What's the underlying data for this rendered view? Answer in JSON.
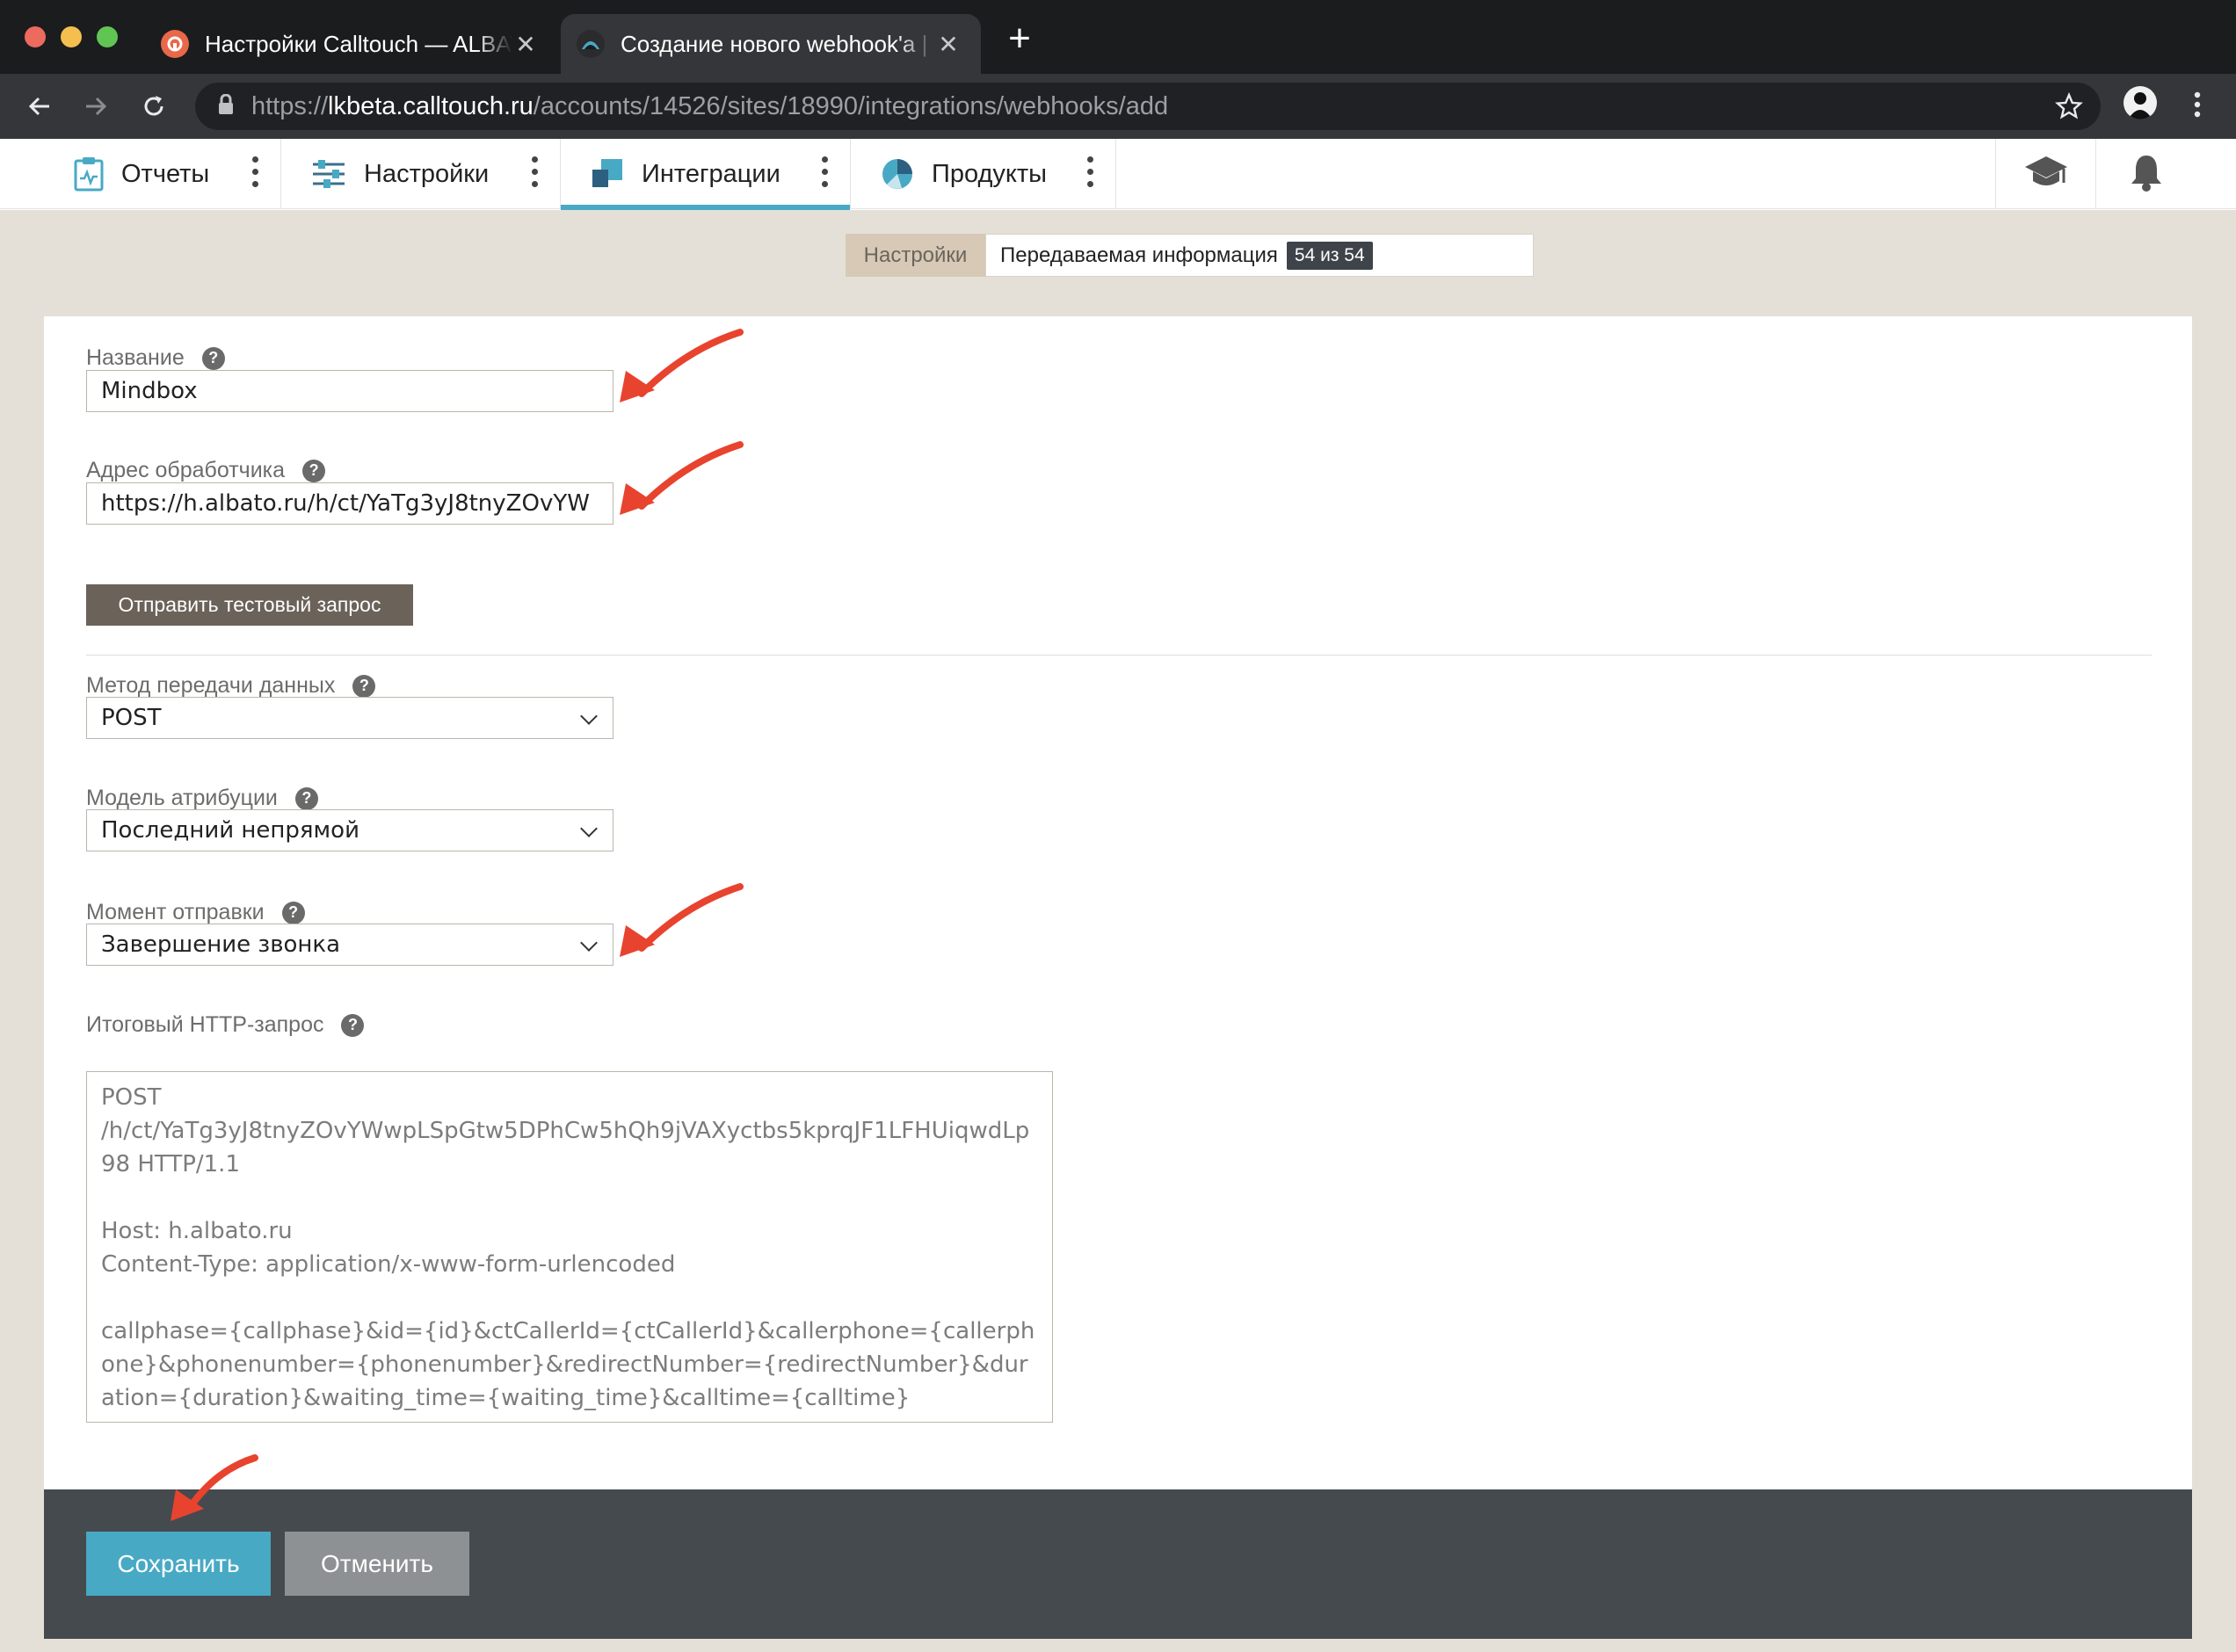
{
  "browser": {
    "tabs": [
      {
        "title": "Настройки Calltouch — ALBATO",
        "active": false
      },
      {
        "title": "Создание нового webhook'а | Calltouch",
        "active": true
      }
    ],
    "close_glyph": "✕",
    "new_tab_glyph": "+",
    "url": {
      "scheme": "https://",
      "host": "lkbeta.calltouch.ru",
      "path": "/accounts/14526/sites/18990/integrations/webhooks/add"
    }
  },
  "nav": {
    "items": [
      {
        "label": "Отчеты",
        "icon": "clipboard-chart-icon"
      },
      {
        "label": "Настройки",
        "icon": "sliders-icon"
      },
      {
        "label": "Интеграции",
        "icon": "integration-squares-icon",
        "active": true
      },
      {
        "label": "Продукты",
        "icon": "globe-pie-icon"
      }
    ],
    "right_icons": [
      "graduation-cap-icon",
      "bell-icon"
    ]
  },
  "subtabs": {
    "settings": "Настройки",
    "info": "Передаваемая информация",
    "info_badge": "54 из 54"
  },
  "form": {
    "name": {
      "label": "Название",
      "value": "Mindbox"
    },
    "handler": {
      "label": "Адрес обработчика",
      "value": "https://h.albato.ru/h/ct/YaTg3yJ8tnyZOvYW"
    },
    "test_button": "Отправить тестовый запрос",
    "method": {
      "label": "Метод передачи данных",
      "value": "POST"
    },
    "attribution": {
      "label": "Модель атрибуции",
      "value": "Последний непрямой"
    },
    "moment": {
      "label": "Момент отправки",
      "value": "Завершение звонка"
    },
    "http_request": {
      "label": "Итоговый HTTP-запрос",
      "value": "POST\n/h/ct/YaTg3yJ8tnyZOvYWwpLSpGtw5DPhCw5hQh9jVAXyctbs5kprqJF1LFHUiqwdLp98 HTTP/1.1\n\nHost: h.albato.ru\nContent-Type: application/x-www-form-urlencoded\n\ncallphase={callphase}&id={id}&ctCallerId={ctCallerId}&callerphone={callerphone}&phonenumber={phonenumber}&redirectNumber={redirectNumber}&duration={duration}&waiting_time={waiting_time}&calltime={calltime}"
    },
    "help_glyph": "?"
  },
  "footer": {
    "save": "Сохранить",
    "cancel": "Отменить"
  },
  "colors": {
    "accent": "#48a9c5",
    "annotation_arrow": "#e8432e",
    "page_bg": "#e5e0d7",
    "footer_bg": "#454a4e"
  }
}
